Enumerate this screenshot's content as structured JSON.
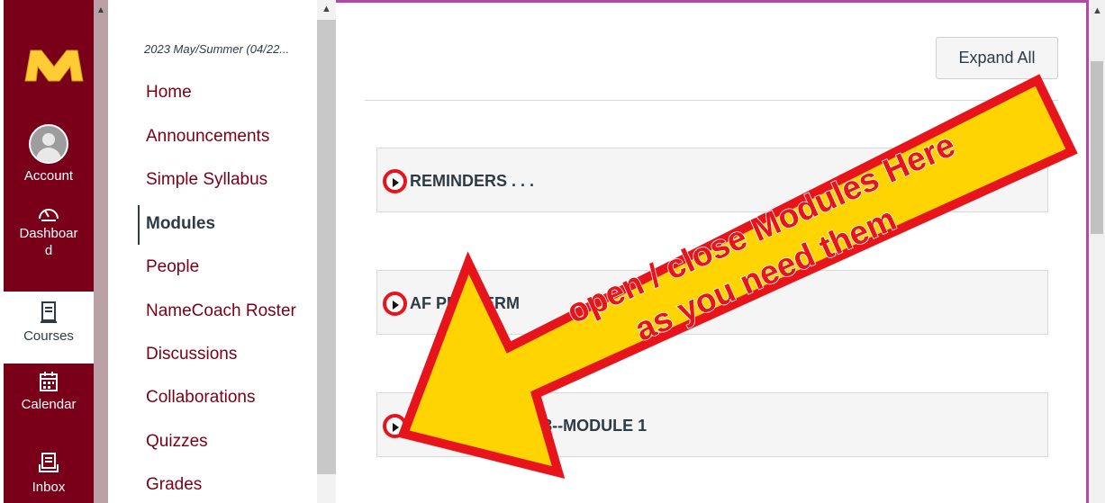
{
  "global_nav": {
    "items": [
      {
        "label": "Account"
      },
      {
        "label": "Dashboard"
      },
      {
        "label": "Courses"
      },
      {
        "label": "Calendar"
      },
      {
        "label": "Inbox"
      }
    ]
  },
  "course_nav": {
    "term": "2023 May/Summer (04/22...",
    "items": [
      {
        "label": "Home"
      },
      {
        "label": "Announcements"
      },
      {
        "label": "Simple Syllabus"
      },
      {
        "label": "Modules"
      },
      {
        "label": "People"
      },
      {
        "label": "NameCoach Roster"
      },
      {
        "label": "Discussions"
      },
      {
        "label": "Collaborations"
      },
      {
        "label": "Quizzes"
      },
      {
        "label": "Grades"
      }
    ]
  },
  "main": {
    "expand_all": "Expand All",
    "modules": [
      {
        "title": "REMINDERS . . ."
      },
      {
        "title": "AF PRE TERM"
      },
      {
        "title": "AF 4 January 2023--MODULE 1"
      }
    ]
  },
  "annotation": {
    "line1": "open / close Modules Here",
    "line2": "as you need them",
    "colors": {
      "fill": "#ffd400",
      "outline": "#e8141b",
      "text": "#e8141b"
    }
  },
  "colors": {
    "maroon": "#7a0019",
    "gold": "#ffcc33",
    "accent_border": "#b04aa6"
  }
}
